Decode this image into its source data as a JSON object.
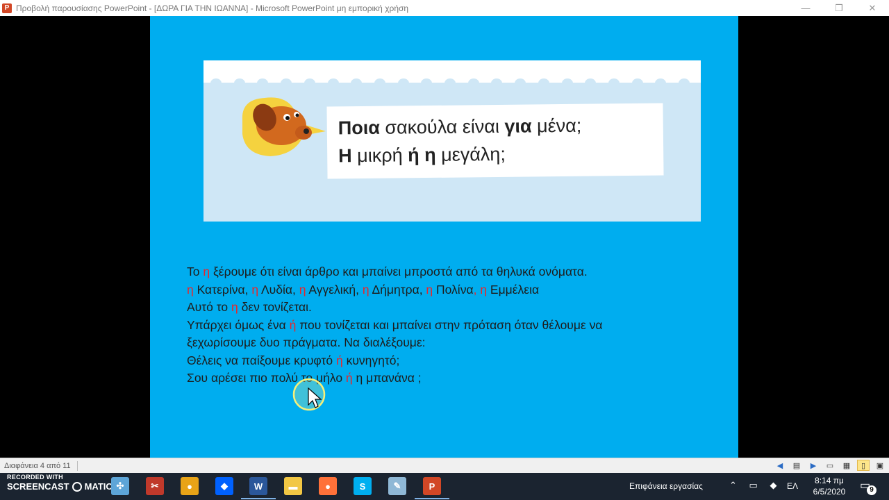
{
  "window": {
    "app_icon_letter": "P",
    "title": "Προβολή παρουσίασης PowerPoint - [ΔΩΡΑ ΓΙΑ ΤΗΝ ΙΩΑΝΝΑ] - Microsoft PowerPoint μη εμπορική χρήση",
    "minimize_symbol": "—",
    "restore_symbol": "❐",
    "close_symbol": "✕"
  },
  "slide": {
    "speech_bubble": {
      "line1_bold1": "Ποια",
      "line1_mid": " σακούλα είναι ",
      "line1_bold2": "για",
      "line1_end": " μένα;",
      "line2_bold1": "Η",
      "line2_mid": " μικρή ",
      "line2_bold2": "ή η",
      "line2_end": " μεγάλη;"
    },
    "body": [
      [
        {
          "t": "Το ",
          "red": false
        },
        {
          "t": "η",
          "red": true
        },
        {
          "t": " ξέρουμε ότι είναι άρθρο και μπαίνει μπροστά από τα θηλυκά ονόματα.",
          "red": false
        }
      ],
      [
        {
          "t": "η",
          "red": true
        },
        {
          "t": " Κατερίνα, ",
          "red": false
        },
        {
          "t": "η",
          "red": true
        },
        {
          "t": " Λυδία, ",
          "red": false
        },
        {
          "t": "η",
          "red": true
        },
        {
          "t": " Αγγελική, ",
          "red": false
        },
        {
          "t": "η",
          "red": true
        },
        {
          "t": " Δήμητρα, ",
          "red": false
        },
        {
          "t": "η",
          "red": true
        },
        {
          "t": " Πολίνα",
          "red": false
        },
        {
          "t": ", η",
          "red": true
        },
        {
          "t": " Εμμέλεια",
          "red": false
        }
      ],
      [
        {
          "t": "Αυτό το ",
          "red": false
        },
        {
          "t": "η",
          "red": true
        },
        {
          "t": " δεν τονίζεται.",
          "red": false
        }
      ],
      [
        {
          "t": "Υπάρχει όμως ένα ",
          "red": false
        },
        {
          "t": "ή",
          "red": true
        },
        {
          "t": " που τονίζεται και μπαίνει στην πρόταση όταν θέλουμε να",
          "red": false
        }
      ],
      [
        {
          "t": "ξεχωρίσουμε δυο πράγματα. Να διαλέξουμε:",
          "red": false
        }
      ],
      [
        {
          "t": "Θέλεις να παίξουμε κρυφτό ",
          "red": false
        },
        {
          "t": "ή",
          "red": true
        },
        {
          "t": " κυνηγητό;",
          "red": false
        }
      ],
      [
        {
          "t": "Σου αρέσει πιο πολύ το μήλο ",
          "red": false
        },
        {
          "t": "ή",
          "red": true
        },
        {
          "t": " η μπανάνα ;",
          "red": false
        }
      ]
    ]
  },
  "statusbar": {
    "slide_counter": "Διαφάνεια 4 από 11"
  },
  "taskbar": {
    "recorded_with": "RECORDED WITH",
    "screencast_left": "SCREENCAST",
    "screencast_right": "MATIC",
    "apps": [
      {
        "name": "pinwheel-app",
        "glyph": "✣",
        "color": "#5da5d8"
      },
      {
        "name": "snipping-tool",
        "glyph": "✂",
        "color": "#c0392b"
      },
      {
        "name": "chrome",
        "glyph": "●",
        "color": "#e8a317"
      },
      {
        "name": "dropbox",
        "glyph": "◆",
        "color": "#0061fe"
      },
      {
        "name": "word",
        "glyph": "W",
        "color": "#2b579a"
      },
      {
        "name": "file-explorer",
        "glyph": "▬",
        "color": "#f2c744"
      },
      {
        "name": "firefox",
        "glyph": "●",
        "color": "#ff7139"
      },
      {
        "name": "skype",
        "glyph": "S",
        "color": "#00aff0"
      },
      {
        "name": "paint",
        "glyph": "✎",
        "color": "#8fb8d6"
      },
      {
        "name": "powerpoint",
        "glyph": "P",
        "color": "#d24726"
      }
    ],
    "desktop_label": "Επιφάνεια εργασίας",
    "language": "ΕΛ",
    "time": "8:14 πμ",
    "date": "6/5/2020",
    "notification_count": "9"
  }
}
